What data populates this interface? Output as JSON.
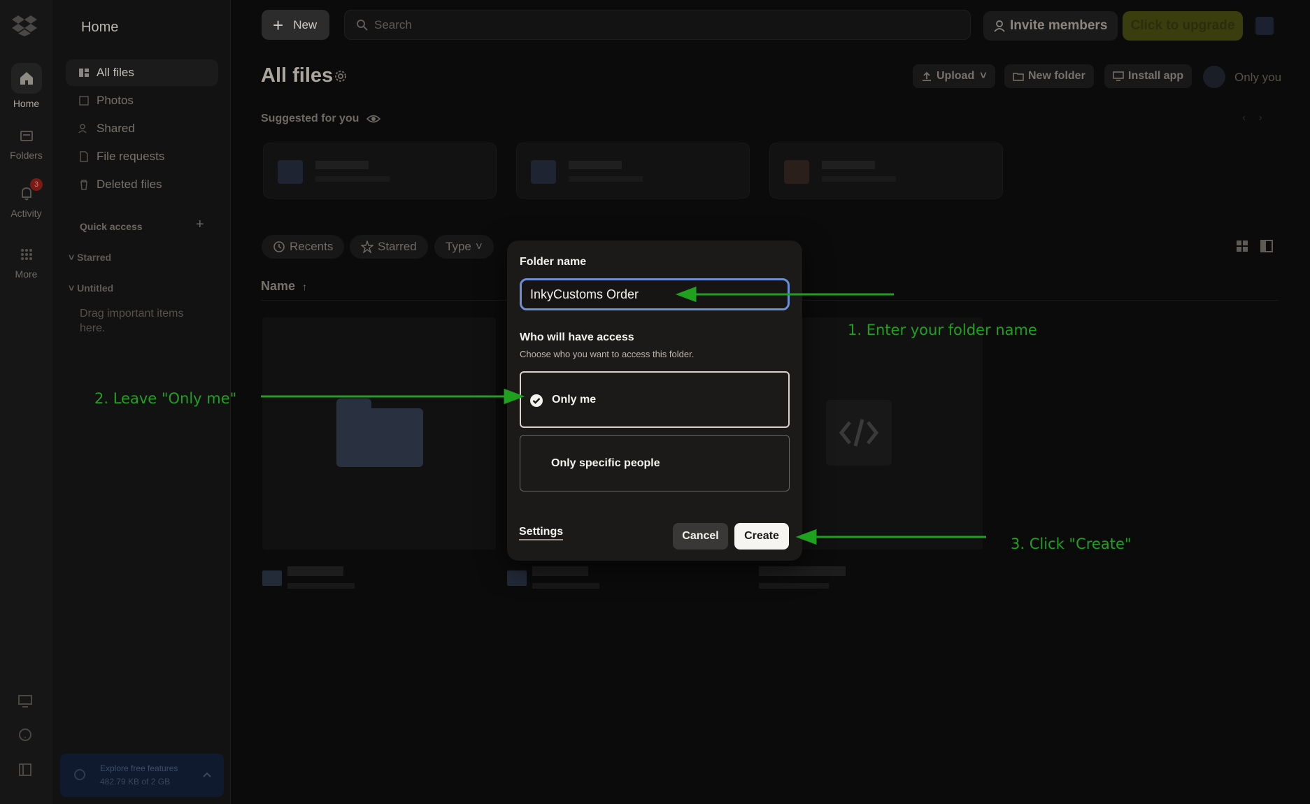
{
  "rail": {
    "home_label": "Home",
    "folders_label": "Folders",
    "activity_label": "Activity",
    "activity_badge": "3",
    "more_label": "More"
  },
  "sidebar": {
    "title": "Home",
    "items": [
      {
        "label": "All files",
        "icon": "all-files-icon",
        "active": true
      },
      {
        "label": "Photos",
        "icon": "photos-icon"
      },
      {
        "label": "Shared",
        "icon": "shared-icon"
      },
      {
        "label": "File requests",
        "icon": "file-requests-icon"
      },
      {
        "label": "Deleted files",
        "icon": "trash-icon"
      }
    ],
    "quick_access": "Quick access",
    "starred": "Starred",
    "untitled": "Untitled",
    "drag_hint": "Drag important items here.",
    "footer_title": "Explore free features",
    "footer_usage": "482.79 KB of 2 GB"
  },
  "topbar": {
    "new_label": "New",
    "search_placeholder": "Search",
    "invite_label": "Invite members",
    "upgrade_label": "Click to upgrade"
  },
  "header": {
    "title": "All files",
    "upload_label": "Upload",
    "new_folder_label": "New folder",
    "install_label": "Install app",
    "owner_label": "Only you"
  },
  "suggested": {
    "title": "Suggested for you"
  },
  "filters": {
    "recents": "Recents",
    "starred": "Starred",
    "type": "Type"
  },
  "list": {
    "name_header": "Name"
  },
  "modal": {
    "folder_name_label": "Folder name",
    "folder_name_value": "InkyCustoms Order",
    "access_title": "Who will have access",
    "access_subtitle": "Choose who you want to access this folder.",
    "options": [
      {
        "label": "Only me",
        "selected": true
      },
      {
        "label": "Only specific people",
        "selected": false
      }
    ],
    "settings_label": "Settings",
    "cancel_label": "Cancel",
    "create_label": "Create"
  },
  "annotations": {
    "step1": "1. Enter your folder name",
    "step2": "2. Leave \"Only me\"",
    "step3": "3. Click \"Create\"",
    "color": "#1fa11f"
  },
  "colors": {
    "accent_input_border": "#6c8fd6",
    "upgrade_bg": "#3a3d0e",
    "annotation": "#1fa11f"
  }
}
